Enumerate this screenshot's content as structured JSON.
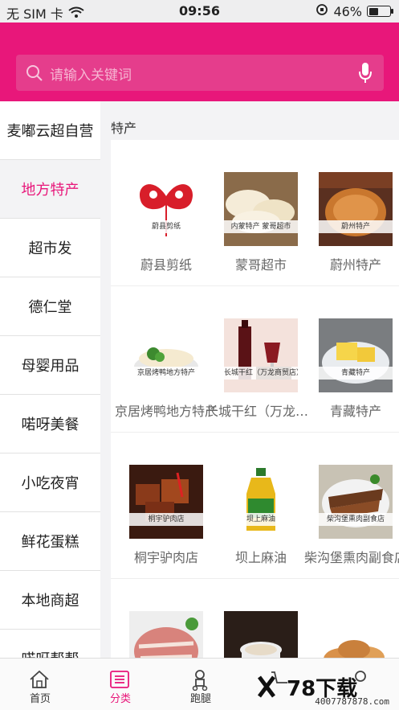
{
  "status_bar": {
    "carrier": "无 SIM 卡",
    "time": "09:56",
    "battery": "46%",
    "battery_level": 0.46
  },
  "search": {
    "placeholder": "请输入关键词"
  },
  "colors": {
    "accent": "#e8177a",
    "search_bg": "#e53d8c"
  },
  "sidebar": {
    "items": [
      {
        "label": "麦嘟云超自营"
      },
      {
        "label": "地方特产"
      },
      {
        "label": "超市发"
      },
      {
        "label": "德仁堂"
      },
      {
        "label": "母婴用品"
      },
      {
        "label": "喏呀美餐"
      },
      {
        "label": "小吃夜宵"
      },
      {
        "label": "鲜花蛋糕"
      },
      {
        "label": "本地商超"
      },
      {
        "label": "喏呀帮帮"
      }
    ],
    "active_index": 1
  },
  "main": {
    "section_title": "特产",
    "rows": [
      [
        {
          "name": "蔚县剪纸",
          "tag": "蔚县剪纸"
        },
        {
          "name": "蒙哥超市",
          "tag": "内蒙特产 蒙哥超市"
        },
        {
          "name": "蔚州特产",
          "tag": "蔚州特产"
        }
      ],
      [
        {
          "name": "京居烤鸭地方特产",
          "tag": "京居烤鸭地方特产"
        },
        {
          "name": "长城干红（万龙商贸店）",
          "tag": "长城干红（万龙商贸店）"
        },
        {
          "name": "青藏特产",
          "tag": "青藏特产"
        }
      ],
      [
        {
          "name": "桐宇驴肉店",
          "tag": "桐宇驴肉店"
        },
        {
          "name": "坝上麻油",
          "tag": "坝上麻油"
        },
        {
          "name": "柴沟堡熏肉副食店",
          "tag": "柴沟堡熏肉副食店"
        }
      ],
      [
        {
          "name": "",
          "tag": ""
        },
        {
          "name": "",
          "tag": ""
        },
        {
          "name": "",
          "tag": ""
        }
      ]
    ]
  },
  "tabbar": {
    "tabs": [
      {
        "label": "首页",
        "icon": "home-icon"
      },
      {
        "label": "分类",
        "icon": "list-icon"
      },
      {
        "label": "跑腿",
        "icon": "rider-icon"
      },
      {
        "label": "",
        "icon": "cart-icon"
      },
      {
        "label": "",
        "icon": "user-icon"
      }
    ],
    "active_index": 1
  },
  "watermark": {
    "text": "78下载",
    "url": "4007787878.com"
  }
}
